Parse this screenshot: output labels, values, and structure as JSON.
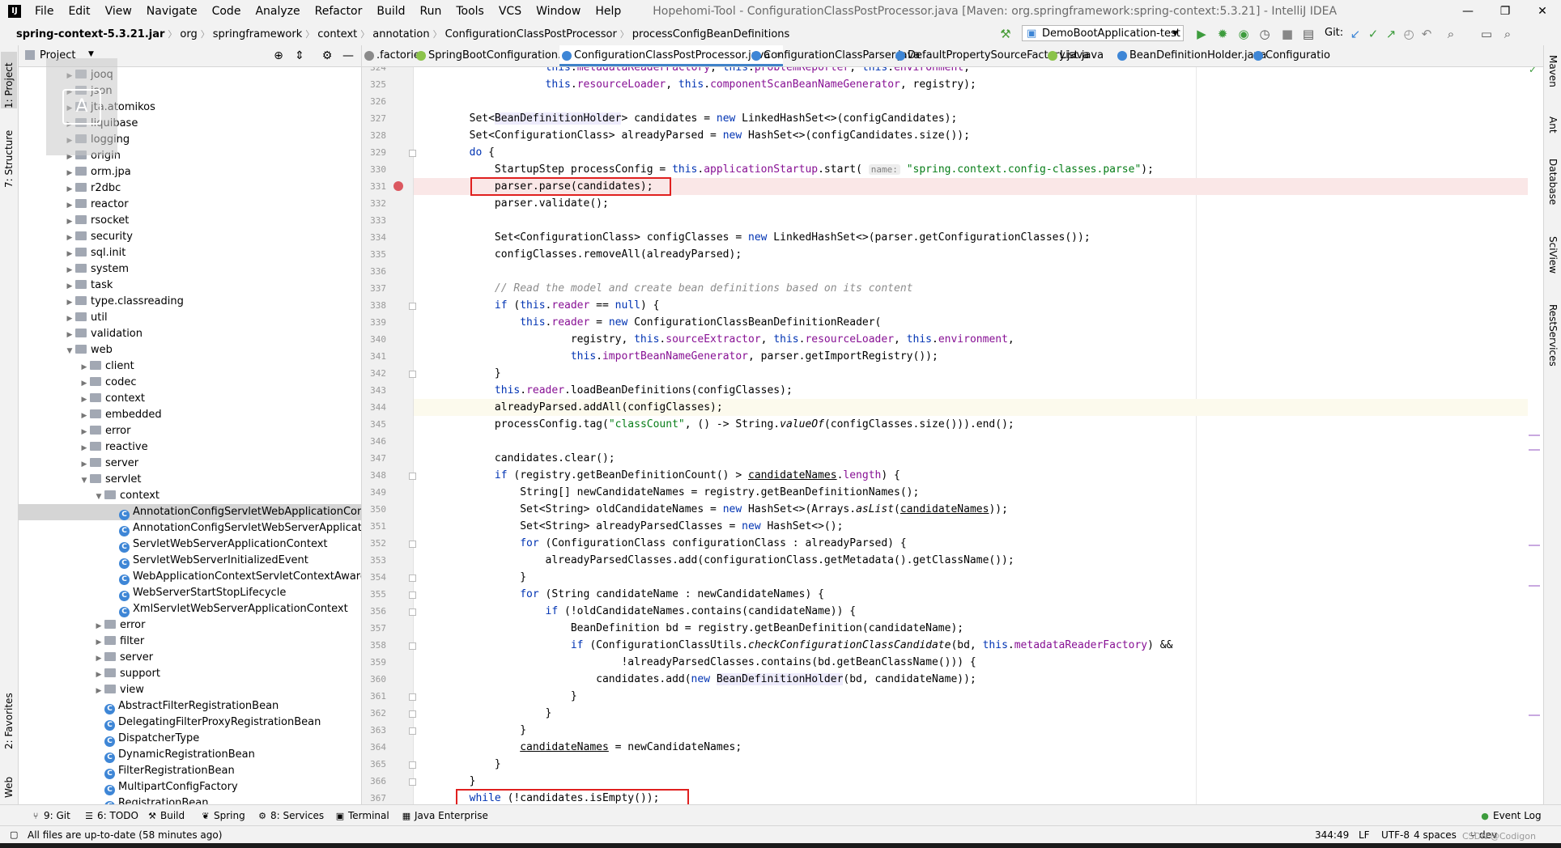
{
  "menubar": {
    "logo": "IJ",
    "items": [
      "File",
      "Edit",
      "View",
      "Navigate",
      "Code",
      "Analyze",
      "Refactor",
      "Build",
      "Run",
      "Tools",
      "VCS",
      "Window",
      "Help"
    ],
    "window_title": "Hopehomi-Tool - ConfigurationClassPostProcessor.java [Maven: org.springframework:spring-context:5.3.21] - IntelliJ IDEA",
    "minimize": "—",
    "maximize": "❐",
    "close": "✕"
  },
  "navbar": {
    "breadcrumbs": [
      "spring-context-5.3.21.jar",
      "org",
      "springframework",
      "context",
      "annotation",
      "ConfigurationClassPostProcessor",
      "processConfigBeanDefinitions"
    ],
    "run_config": "DemoBootApplication-test",
    "git_label": "Git:"
  },
  "left_tabs": [
    "1: Project",
    "7: Structure",
    "2: Favorites",
    "Web"
  ],
  "right_tabs": [
    "Maven",
    "Ant",
    "Database",
    "SciView",
    "RestServices"
  ],
  "project": {
    "title": "Project",
    "tree": [
      {
        "label": "jooq",
        "depth": 0,
        "kind": "folder",
        "open": false
      },
      {
        "label": "json",
        "depth": 0,
        "kind": "folder",
        "open": false
      },
      {
        "label": "jta.atomikos",
        "depth": 0,
        "kind": "folder",
        "open": false
      },
      {
        "label": "liquibase",
        "depth": 0,
        "kind": "folder",
        "open": false
      },
      {
        "label": "logging",
        "depth": 0,
        "kind": "folder",
        "open": false
      },
      {
        "label": "origin",
        "depth": 0,
        "kind": "folder",
        "open": false
      },
      {
        "label": "orm.jpa",
        "depth": 0,
        "kind": "folder",
        "open": false
      },
      {
        "label": "r2dbc",
        "depth": 0,
        "kind": "folder",
        "open": false
      },
      {
        "label": "reactor",
        "depth": 0,
        "kind": "folder",
        "open": false
      },
      {
        "label": "rsocket",
        "depth": 0,
        "kind": "folder",
        "open": false
      },
      {
        "label": "security",
        "depth": 0,
        "kind": "folder",
        "open": false
      },
      {
        "label": "sql.init",
        "depth": 0,
        "kind": "folder",
        "open": false
      },
      {
        "label": "system",
        "depth": 0,
        "kind": "folder",
        "open": false
      },
      {
        "label": "task",
        "depth": 0,
        "kind": "folder",
        "open": false
      },
      {
        "label": "type.classreading",
        "depth": 0,
        "kind": "folder",
        "open": false
      },
      {
        "label": "util",
        "depth": 0,
        "kind": "folder",
        "open": false
      },
      {
        "label": "validation",
        "depth": 0,
        "kind": "folder",
        "open": false
      },
      {
        "label": "web",
        "depth": 0,
        "kind": "folder",
        "open": true
      },
      {
        "label": "client",
        "depth": 1,
        "kind": "folder",
        "open": false
      },
      {
        "label": "codec",
        "depth": 1,
        "kind": "folder",
        "open": false
      },
      {
        "label": "context",
        "depth": 1,
        "kind": "folder",
        "open": false
      },
      {
        "label": "embedded",
        "depth": 1,
        "kind": "folder",
        "open": false
      },
      {
        "label": "error",
        "depth": 1,
        "kind": "folder",
        "open": false
      },
      {
        "label": "reactive",
        "depth": 1,
        "kind": "folder",
        "open": false
      },
      {
        "label": "server",
        "depth": 1,
        "kind": "folder",
        "open": false
      },
      {
        "label": "servlet",
        "depth": 1,
        "kind": "folder",
        "open": true
      },
      {
        "label": "context",
        "depth": 2,
        "kind": "folder",
        "open": true
      },
      {
        "label": "AnnotationConfigServletWebApplicationContext",
        "depth": 3,
        "kind": "class",
        "selected": true
      },
      {
        "label": "AnnotationConfigServletWebServerApplicationContext",
        "depth": 3,
        "kind": "class"
      },
      {
        "label": "ServletWebServerApplicationContext",
        "depth": 3,
        "kind": "class"
      },
      {
        "label": "ServletWebServerInitializedEvent",
        "depth": 3,
        "kind": "class"
      },
      {
        "label": "WebApplicationContextServletContextAwareProcessor",
        "depth": 3,
        "kind": "class"
      },
      {
        "label": "WebServerStartStopLifecycle",
        "depth": 3,
        "kind": "class"
      },
      {
        "label": "XmlServletWebServerApplicationContext",
        "depth": 3,
        "kind": "class"
      },
      {
        "label": "error",
        "depth": 2,
        "kind": "folder",
        "open": false
      },
      {
        "label": "filter",
        "depth": 2,
        "kind": "folder",
        "open": false
      },
      {
        "label": "server",
        "depth": 2,
        "kind": "folder",
        "open": false
      },
      {
        "label": "support",
        "depth": 2,
        "kind": "folder",
        "open": false
      },
      {
        "label": "view",
        "depth": 2,
        "kind": "folder",
        "open": false
      },
      {
        "label": "AbstractFilterRegistrationBean",
        "depth": 2,
        "kind": "class"
      },
      {
        "label": "DelegatingFilterProxyRegistrationBean",
        "depth": 2,
        "kind": "class"
      },
      {
        "label": "DispatcherType",
        "depth": 2,
        "kind": "class"
      },
      {
        "label": "DynamicRegistrationBean",
        "depth": 2,
        "kind": "class"
      },
      {
        "label": "FilterRegistrationBean",
        "depth": 2,
        "kind": "class"
      },
      {
        "label": "MultipartConfigFactory",
        "depth": 2,
        "kind": "class"
      },
      {
        "label": "RegistrationBean",
        "depth": 2,
        "kind": "class"
      }
    ]
  },
  "editor_tabs": [
    {
      "label": ".factories",
      "active": false,
      "color": "#8a8a8a"
    },
    {
      "label": "SpringBootConfiguration.java",
      "active": false,
      "color": "#8bc34a"
    },
    {
      "label": "ConfigurationClassPostProcessor.java",
      "active": true,
      "color": "#3e86d6"
    },
    {
      "label": "ConfigurationClassParser.java",
      "active": false,
      "color": "#3e86d6"
    },
    {
      "label": "DefaultPropertySourceFactory.java",
      "active": false,
      "color": "#3e86d6"
    },
    {
      "label": "List.java",
      "active": false,
      "color": "#8bc34a"
    },
    {
      "label": "BeanDefinitionHolder.java",
      "active": false,
      "color": "#3e86d6"
    },
    {
      "label": "Configuratio",
      "active": false,
      "color": "#3e86d6"
    }
  ],
  "editor": {
    "lines": [
      {
        "n": "324",
        "html": "\t\t\t\t\t<span class=\"kw\">this</span>.<span class=\"fld\">metadataReaderFactory</span>, <span class=\"kw\">this</span>.<span class=\"fld\">problemReporter</span>, <span class=\"kw\">this</span>.<span class=\"fld\">environment</span>,"
      },
      {
        "n": "325",
        "html": "\t\t\t\t\t<span class=\"kw\">this</span>.<span class=\"fld\">resourceLoader</span>, <span class=\"kw\">this</span>.<span class=\"fld\">componentScanBeanNameGenerator</span>, registry);"
      },
      {
        "n": "326",
        "html": ""
      },
      {
        "n": "327",
        "html": "\t\tSet&lt;<span class=\"bh\">BeanDefinitionHolder</span>&gt; candidates = <span class=\"kw\">new</span> LinkedHashSet&lt;&gt;(configCandidates);"
      },
      {
        "n": "328",
        "html": "\t\tSet&lt;ConfigurationClass&gt; alreadyParsed = <span class=\"kw\">new</span> HashSet&lt;&gt;(configCandidates.size());"
      },
      {
        "n": "329",
        "html": "\t\t<span class=\"kw\">do</span> {"
      },
      {
        "n": "330",
        "html": "\t\t\tStartupStep processConfig = <span class=\"kw\">this</span>.<span class=\"fld\">applicationStartup</span>.start( <span class=\"hint\">name:</span> <span class=\"str\">\"spring.context.config-classes.parse\"</span>);"
      },
      {
        "n": "331",
        "html": "\t\t\tparser.parse(candidates);",
        "bp": true
      },
      {
        "n": "332",
        "html": "\t\t\tparser.validate();"
      },
      {
        "n": "333",
        "html": ""
      },
      {
        "n": "334",
        "html": "\t\t\tSet&lt;ConfigurationClass&gt; configClasses = <span class=\"kw\">new</span> LinkedHashSet&lt;&gt;(parser.getConfigurationClasses());"
      },
      {
        "n": "335",
        "html": "\t\t\tconfigClasses.removeAll(alreadyParsed);"
      },
      {
        "n": "336",
        "html": ""
      },
      {
        "n": "337",
        "html": "\t\t\t<span class=\"cmt\">// Read the model and create bean definitions based on its content</span>"
      },
      {
        "n": "338",
        "html": "\t\t\t<span class=\"kw\">if</span> (<span class=\"kw\">this</span>.<span class=\"fld\">reader</span> == <span class=\"kw\">null</span>) {"
      },
      {
        "n": "339",
        "html": "\t\t\t\t<span class=\"kw\">this</span>.<span class=\"fld\">reader</span> = <span class=\"kw\">new</span> ConfigurationClassBeanDefinitionReader("
      },
      {
        "n": "340",
        "html": "\t\t\t\t\t\tregistry, <span class=\"kw\">this</span>.<span class=\"fld\">sourceExtractor</span>, <span class=\"kw\">this</span>.<span class=\"fld\">resourceLoader</span>, <span class=\"kw\">this</span>.<span class=\"fld\">environment</span>,"
      },
      {
        "n": "341",
        "html": "\t\t\t\t\t\t<span class=\"kw\">this</span>.<span class=\"fld\">importBeanNameGenerator</span>, parser.getImportRegistry());"
      },
      {
        "n": "342",
        "html": "\t\t\t}"
      },
      {
        "n": "343",
        "html": "\t\t\t<span class=\"kw\">this</span>.<span class=\"fld\">reader</span>.loadBeanDefinitions(configClasses);"
      },
      {
        "n": "344",
        "html": "\t\t\talreadyParsed.addAll(configClasses);",
        "cur": true
      },
      {
        "n": "345",
        "html": "\t\t\tprocessConfig.tag(<span class=\"str\">\"classCount\"</span>, () -&gt; String.<span class=\"itl\">valueOf</span>(configClasses.size())).end();"
      },
      {
        "n": "346",
        "html": ""
      },
      {
        "n": "347",
        "html": "\t\t\tcandidates.clear();"
      },
      {
        "n": "348",
        "html": "\t\t\t<span class=\"kw\">if</span> (registry.getBeanDefinitionCount() &gt; <span class=\"und\">candidateNames</span>.<span class=\"fld\">length</span>) {"
      },
      {
        "n": "349",
        "html": "\t\t\t\tString[] newCandidateNames = registry.getBeanDefinitionNames();"
      },
      {
        "n": "350",
        "html": "\t\t\t\tSet&lt;String&gt; oldCandidateNames = <span class=\"kw\">new</span> HashSet&lt;&gt;(Arrays.<span class=\"itl\">asList</span>(<span class=\"und\">candidateNames</span>));"
      },
      {
        "n": "351",
        "html": "\t\t\t\tSet&lt;String&gt; alreadyParsedClasses = <span class=\"kw\">new</span> HashSet&lt;&gt;();"
      },
      {
        "n": "352",
        "html": "\t\t\t\t<span class=\"kw\">for</span> (ConfigurationClass configurationClass : alreadyParsed) {"
      },
      {
        "n": "353",
        "html": "\t\t\t\t\talreadyParsedClasses.add(configurationClass.getMetadata().getClassName());"
      },
      {
        "n": "354",
        "html": "\t\t\t\t}"
      },
      {
        "n": "355",
        "html": "\t\t\t\t<span class=\"kw\">for</span> (String candidateName : newCandidateNames) {"
      },
      {
        "n": "356",
        "html": "\t\t\t\t\t<span class=\"kw\">if</span> (!oldCandidateNames.contains(candidateName)) {"
      },
      {
        "n": "357",
        "html": "\t\t\t\t\t\tBeanDefinition bd = registry.getBeanDefinition(candidateName);"
      },
      {
        "n": "358",
        "html": "\t\t\t\t\t\t<span class=\"kw\">if</span> (ConfigurationClassUtils.<span class=\"itl\">checkConfigurationClassCandidate</span>(bd, <span class=\"kw\">this</span>.<span class=\"fld\">metadataReaderFactory</span>) &amp;&amp;"
      },
      {
        "n": "359",
        "html": "\t\t\t\t\t\t\t\t!alreadyParsedClasses.contains(bd.getBeanClassName())) {"
      },
      {
        "n": "360",
        "html": "\t\t\t\t\t\t\tcandidates.add(<span class=\"kw\">new</span> <span class=\"bh\">BeanDefinitionHolder</span>(bd, candidateName));"
      },
      {
        "n": "361",
        "html": "\t\t\t\t\t\t}"
      },
      {
        "n": "362",
        "html": "\t\t\t\t\t}"
      },
      {
        "n": "363",
        "html": "\t\t\t\t}"
      },
      {
        "n": "364",
        "html": "\t\t\t\t<span class=\"und\">candidateNames</span> = newCandidateNames;"
      },
      {
        "n": "365",
        "html": "\t\t\t}"
      },
      {
        "n": "366",
        "html": "\t\t}"
      },
      {
        "n": "367",
        "html": "\t\t<span class=\"kw\">while</span> (!candidates.isEmpty());"
      }
    ]
  },
  "bottom_tools": [
    {
      "label": "9: Git",
      "icon": "⑂"
    },
    {
      "label": "6: TODO",
      "icon": "☰"
    },
    {
      "label": "Build",
      "icon": "⚒"
    },
    {
      "label": "Spring",
      "icon": "❦"
    },
    {
      "label": "8: Services",
      "icon": "⚙"
    },
    {
      "label": "Terminal",
      "icon": "▣"
    },
    {
      "label": "Java Enterprise",
      "icon": "▦"
    }
  ],
  "event_log": "Event Log",
  "status": {
    "message": "All files are up-to-date (58 minutes ago)",
    "position": "344:49",
    "line_sep": "LF",
    "encoding": "UTF-8",
    "indent": "4 spaces",
    "branch": "dev",
    "watermark": "CSDN @Codigon"
  }
}
